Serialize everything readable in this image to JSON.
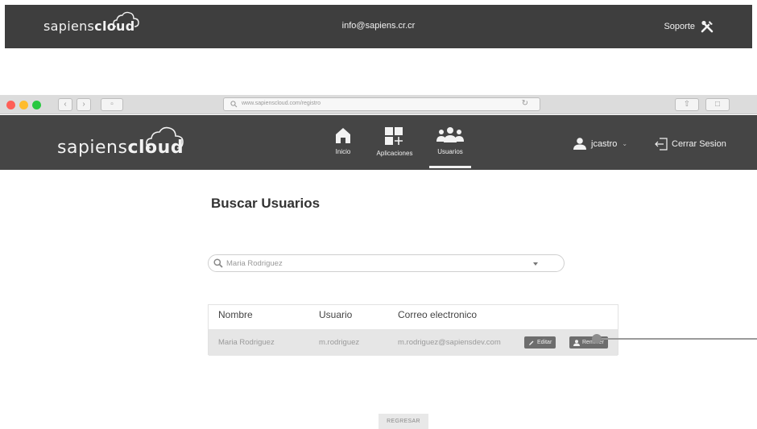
{
  "outer": {
    "logo_light": "sapiens",
    "logo_bold": "cloud",
    "email": "info@sapiens.cr.cr",
    "support_label": "Soporte",
    "support_icon": "tools-icon"
  },
  "browser": {
    "url": "www.sapienscloud.com/registro",
    "traffic_colors": [
      "#ff5f57",
      "#febc2e",
      "#28c840"
    ]
  },
  "header": {
    "logo_light": "sapiens",
    "logo_bold": "cloud",
    "nav": [
      {
        "label": "Inicio",
        "icon": "home-icon"
      },
      {
        "label": "Aplicaciones",
        "icon": "apps-icon"
      },
      {
        "label": "Usuarios",
        "icon": "users-icon",
        "active": true
      }
    ],
    "user_name": "jcastro",
    "logout_label": "Cerrar Sesion"
  },
  "main": {
    "title": "Buscar Usuarios",
    "search_value": "Maria Rodriguez",
    "table": {
      "columns": [
        "Nombre",
        "Usuario",
        "Correo electronico"
      ],
      "rows": [
        {
          "nombre": "Maria Rodriguez",
          "usuario": "m.rodriguez",
          "correo": "m.rodriguez@sapiensdev.com",
          "edit_label": "Editar",
          "remove_label": "Rem...er"
        }
      ]
    },
    "back_label": "REGRESAR"
  }
}
